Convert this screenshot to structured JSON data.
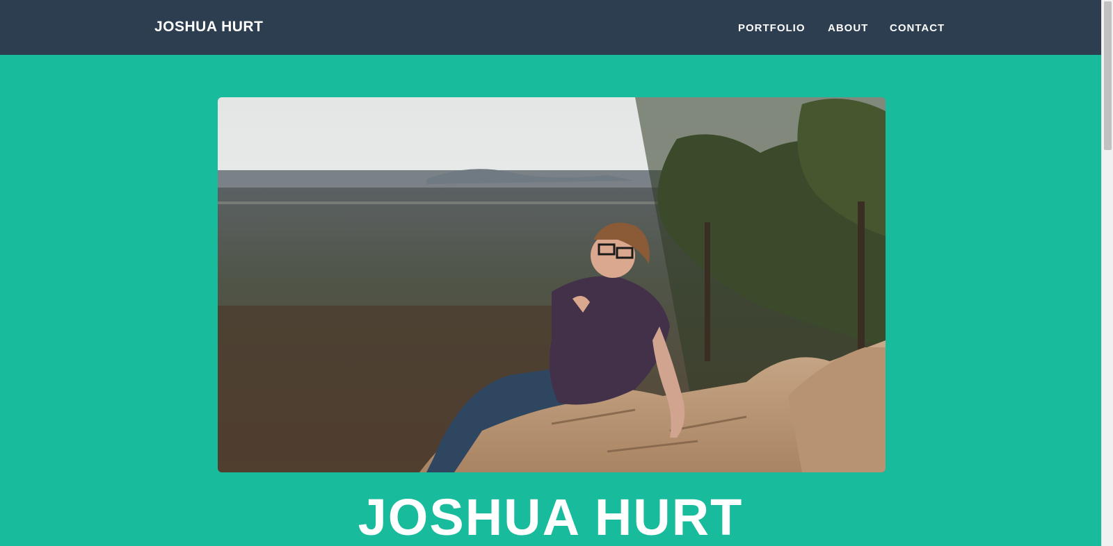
{
  "navbar": {
    "brand": "JOSHUA HURT",
    "links": [
      {
        "label": "PORTFOLIO"
      },
      {
        "label": "ABOUT"
      },
      {
        "label": "CONTACT"
      }
    ]
  },
  "hero": {
    "title": "JOSHUA HURT",
    "photo_alt": "Man with glasses sitting on a rock ledge overlooking a valley"
  },
  "colors": {
    "navbar_bg": "#2c3e50",
    "page_bg": "#18bc9c",
    "text": "#ffffff"
  }
}
